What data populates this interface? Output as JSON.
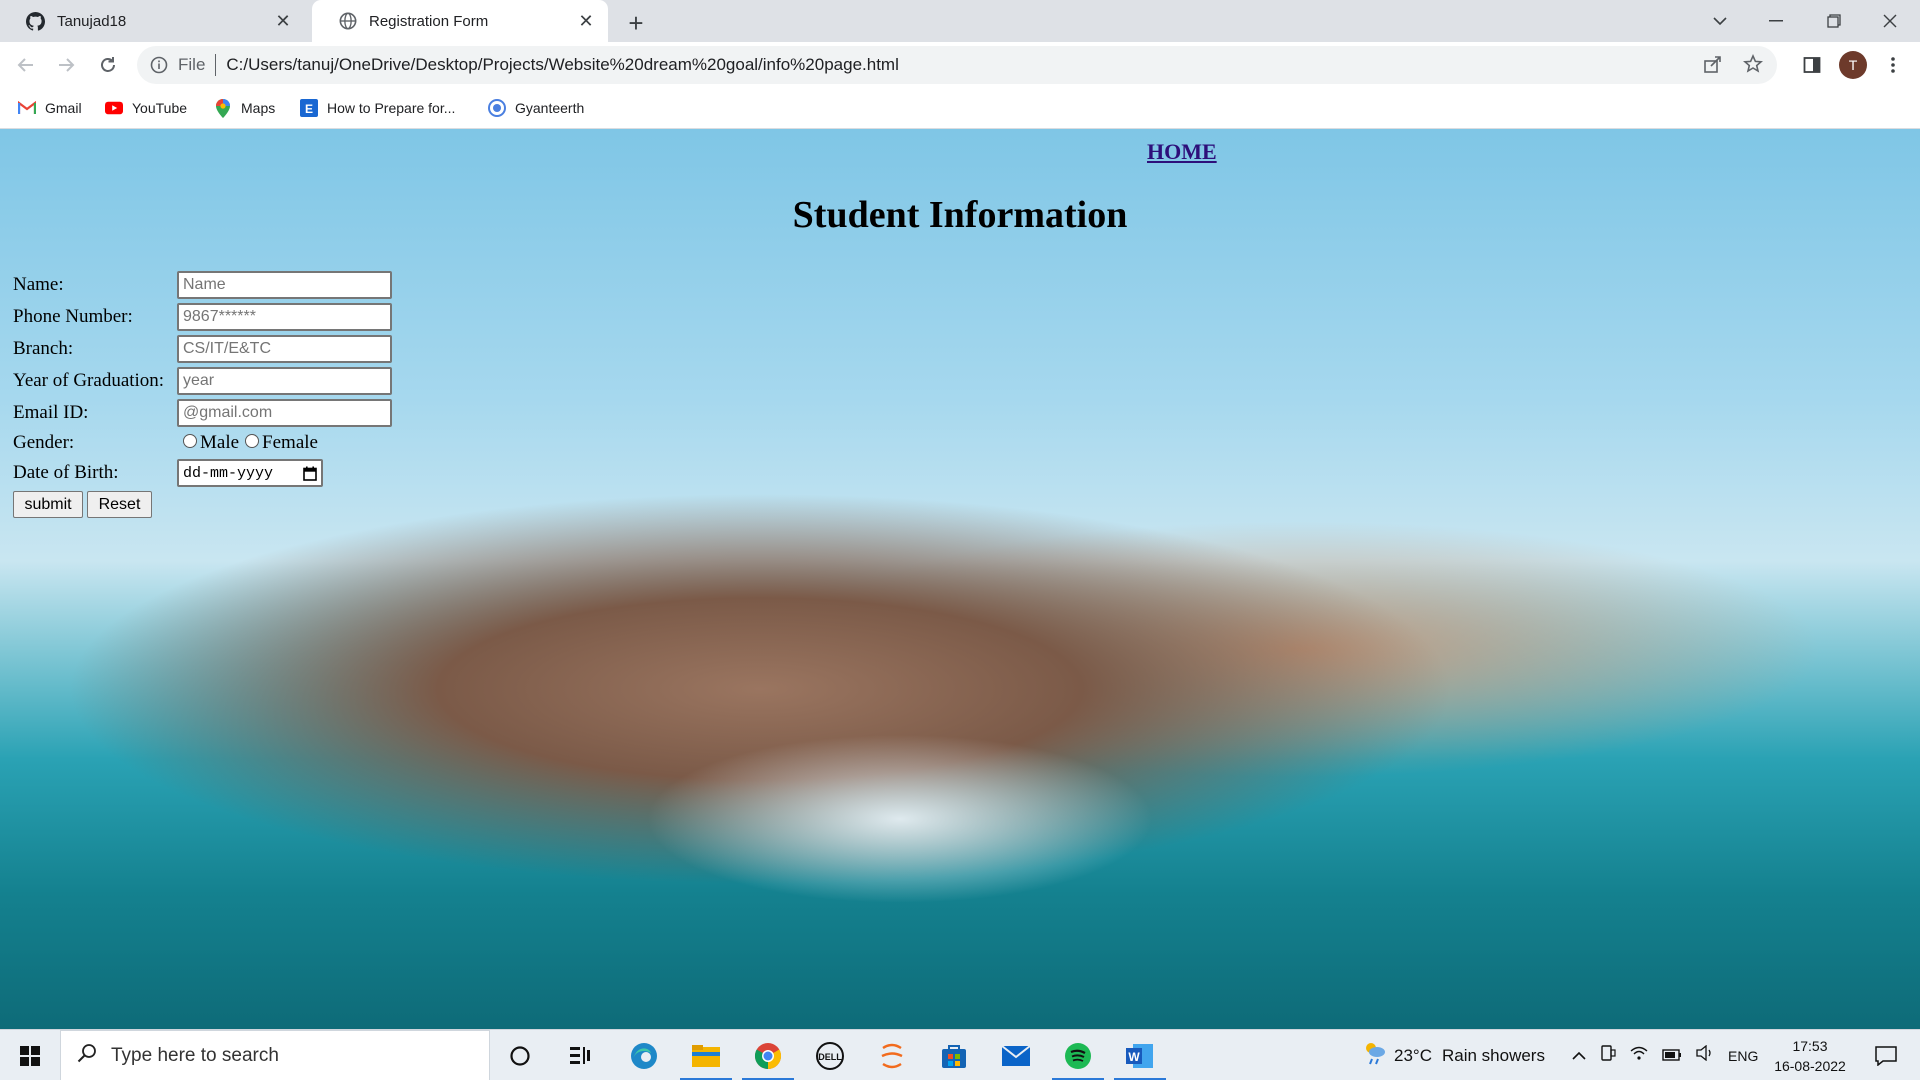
{
  "browser": {
    "tabs": [
      {
        "title": "Tanujad18",
        "favicon": "github-icon"
      },
      {
        "title": "Registration Form",
        "favicon": "globe-icon"
      }
    ],
    "address": {
      "scheme_label": "File",
      "url": "C:/Users/tanuj/OneDrive/Desktop/Projects/Website%20dream%20goal/info%20page.html"
    },
    "profile_initial": "T",
    "bookmarks": [
      {
        "label": "Gmail",
        "icon": "gmail-icon"
      },
      {
        "label": "YouTube",
        "icon": "youtube-icon"
      },
      {
        "label": "Maps",
        "icon": "maps-icon"
      },
      {
        "label": "How to Prepare for...",
        "icon": "bookmark-e-icon"
      },
      {
        "label": "Gyanteerth",
        "icon": "gyanteerth-icon"
      }
    ]
  },
  "page": {
    "home_link": "HOME",
    "title": "Student Information",
    "form": {
      "fields": [
        {
          "label": "Name:",
          "placeholder": "Name"
        },
        {
          "label": "Phone Number:",
          "placeholder": "9867******"
        },
        {
          "label": "Branch:",
          "placeholder": "CS/IT/E&TC"
        },
        {
          "label": "Year of Graduation:",
          "placeholder": "year"
        },
        {
          "label": "Email ID:",
          "placeholder": "@gmail.com"
        }
      ],
      "gender": {
        "label": "Gender:",
        "options": [
          "Male",
          "Female"
        ]
      },
      "dob": {
        "label": "Date of Birth:",
        "placeholder": "dd-mm-yyyy"
      },
      "submit_label": "submit",
      "reset_label": "Reset"
    }
  },
  "taskbar": {
    "search_placeholder": "Type here to search",
    "weather": {
      "temp": "23°C",
      "condition": "Rain showers"
    },
    "language": "ENG",
    "time": "17:53",
    "date": "16-08-2022"
  },
  "colors": {
    "link": "#2d0f7a",
    "taskbar_accent": "#2b79d8"
  }
}
